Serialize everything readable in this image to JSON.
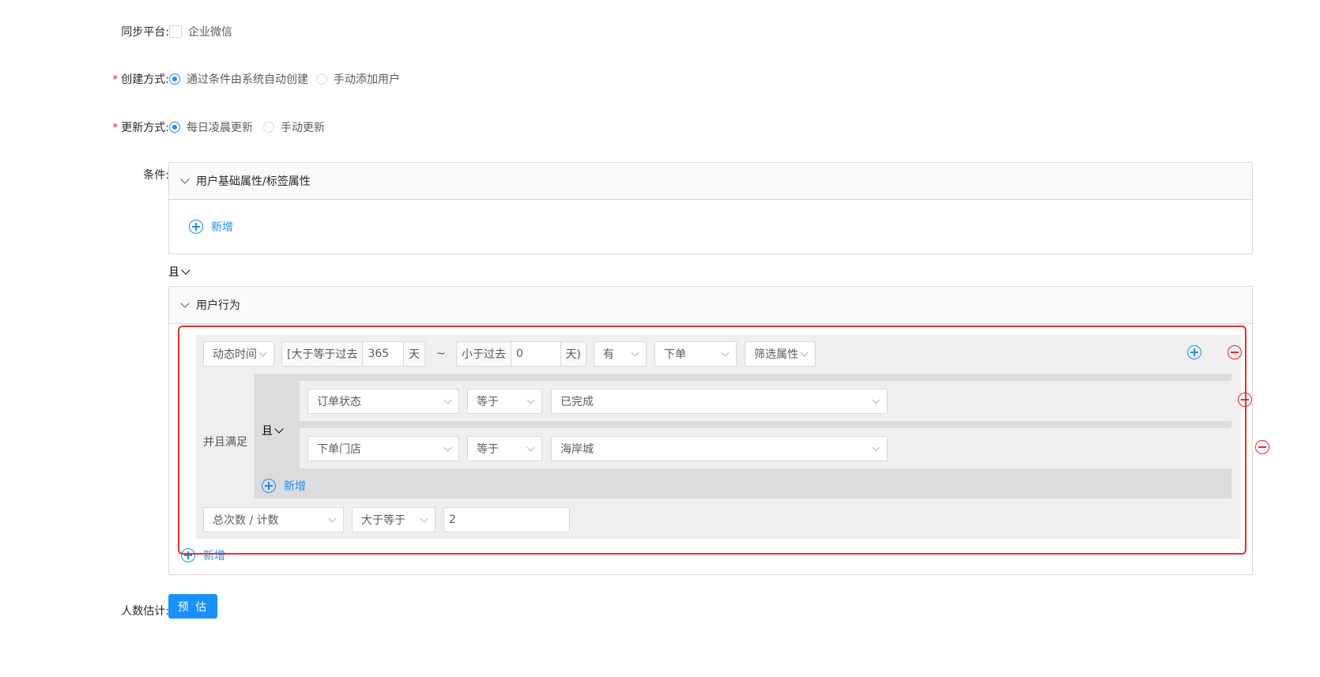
{
  "form": {
    "sync": {
      "label": "同步平台:",
      "option": "企业微信"
    },
    "create": {
      "required_mark": "*",
      "label": "创建方式:",
      "options": [
        "通过条件由系统自动创建",
        "手动添加用户"
      ]
    },
    "update": {
      "required_mark": "*",
      "label": "更新方式:",
      "options": [
        "每日凌晨更新",
        "手动更新"
      ]
    },
    "conditions_label": "条件:",
    "estimate_label": "人数估计:",
    "estimate_button": "预 估"
  },
  "panel1": {
    "title": "用户基础属性/标签属性",
    "add_label": "新增"
  },
  "logic_op": "且",
  "panel2": {
    "title": "用户行为",
    "add_label": "新增",
    "rule": {
      "time_type": "动态时间",
      "from_prefix": "[大于等于过去",
      "from_value": "365",
      "from_suffix": "天",
      "tilde": "~",
      "to_prefix": "小于过去",
      "to_value": "0",
      "to_suffix": "天)",
      "has": "有",
      "event": "下单",
      "filter": "筛选属性",
      "and_meet": "并且满足",
      "sub_logic": "且",
      "sub_conditions": [
        {
          "field": "订单状态",
          "op": "等于",
          "value": "已完成"
        },
        {
          "field": "下单门店",
          "op": "等于",
          "value": "海岸城"
        }
      ],
      "sub_add_label": "新增",
      "metric": "总次数 / 计数",
      "metric_op": "大于等于",
      "metric_value": "2"
    }
  },
  "colors": {
    "primary": "#1890ff",
    "danger": "#f5222d",
    "highlight_border": "#e8312a"
  }
}
